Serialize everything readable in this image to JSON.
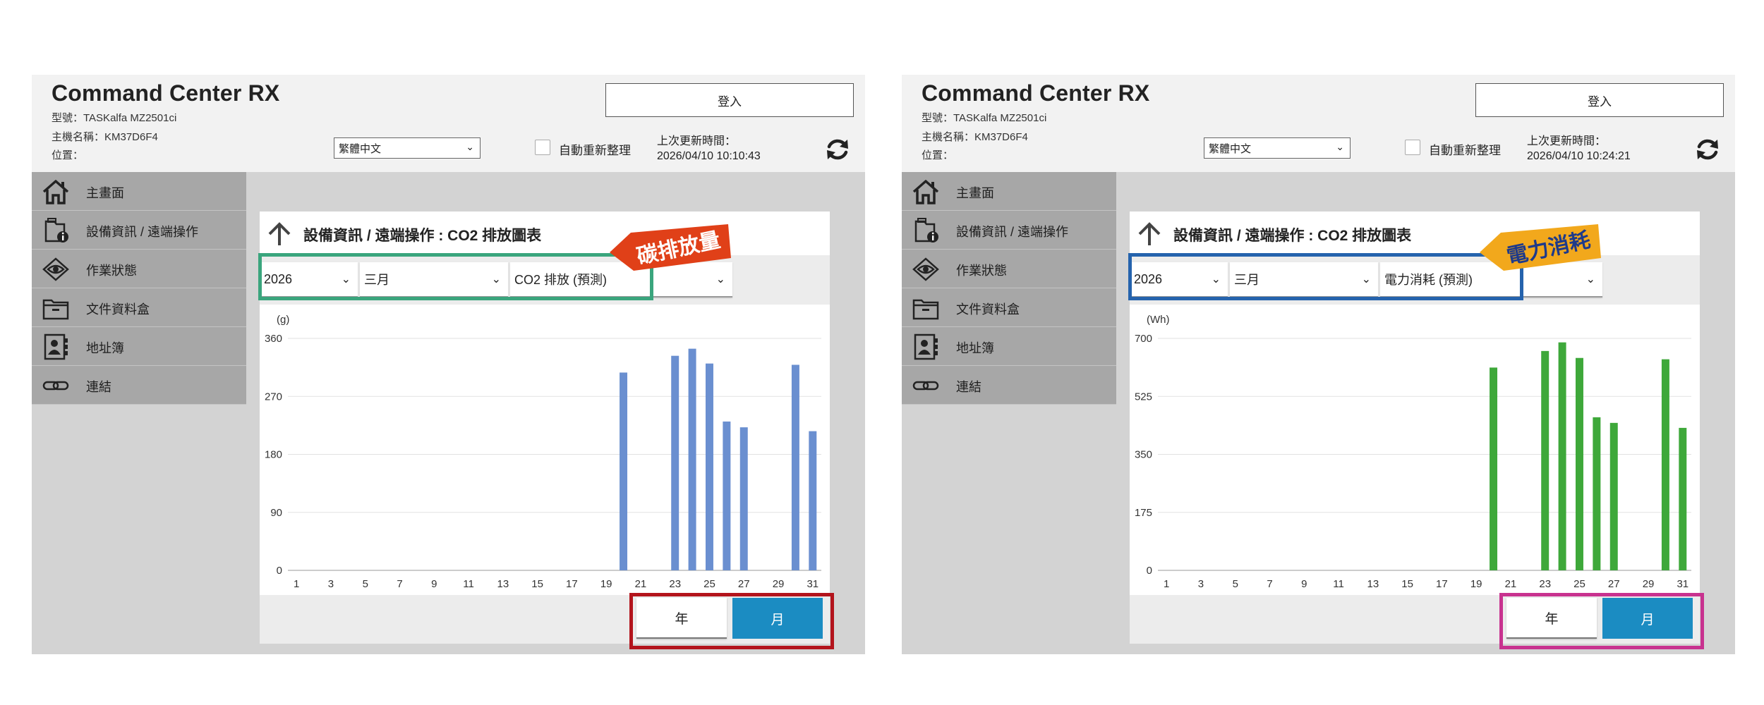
{
  "panels": [
    {
      "app_title": "Command Center RX",
      "model_line": "型號：TASKalfa MZ2501ci",
      "host_line": "主機名稱：KM37D6F4",
      "location_line": "位置：",
      "login_label": "登入",
      "language": "繁體中文",
      "auto_refresh_label": "自動重新整理",
      "last_update_label": "上次更新時間：",
      "last_update_value": "2026/04/10 10:10:43",
      "sidebar": [
        "主畫面",
        "設備資訊 / 遠端操作",
        "作業狀態",
        "文件資料盒",
        "地址簿",
        "連結"
      ],
      "breadcrumb": "設備資訊 / 遠端操作 : CO2 排放圖表",
      "year": "2026",
      "month": "三月",
      "metric": "CO2 排放 (預測)",
      "year_button": "年",
      "month_button": "月",
      "callout": "碳排放量",
      "highlight_color": "#3aa57d",
      "callout_color": "#e04018",
      "bottom_highlight_color": "#b3141c",
      "bar_color": "#6a8fd0"
    },
    {
      "app_title": "Command Center RX",
      "model_line": "型號：TASKalfa MZ2501ci",
      "host_line": "主機名稱：KM37D6F4",
      "location_line": "位置：",
      "login_label": "登入",
      "language": "繁體中文",
      "auto_refresh_label": "自動重新整理",
      "last_update_label": "上次更新時間：",
      "last_update_value": "2026/04/10 10:24:21",
      "sidebar": [
        "主畫面",
        "設備資訊 / 遠端操作",
        "作業狀態",
        "文件資料盒",
        "地址簿",
        "連結"
      ],
      "breadcrumb": "設備資訊 / 遠端操作 : CO2 排放圖表",
      "year": "2026",
      "month": "三月",
      "metric": "電力消耗 (預測)",
      "year_button": "年",
      "month_button": "月",
      "callout": "電力消耗",
      "highlight_color": "#2563ad",
      "callout_color": "#f2a81c",
      "bottom_highlight_color": "#c8328f",
      "bar_color": "#3ea83a"
    }
  ],
  "chart_data": [
    {
      "type": "bar",
      "ylabel": "(g)",
      "ylim": [
        0,
        360
      ],
      "yticks": [
        0,
        90,
        180,
        270,
        360
      ],
      "x": [
        1,
        2,
        3,
        4,
        5,
        6,
        7,
        8,
        9,
        10,
        11,
        12,
        13,
        14,
        15,
        16,
        17,
        18,
        19,
        20,
        21,
        22,
        23,
        24,
        25,
        26,
        27,
        28,
        29,
        30,
        31
      ],
      "xtick_labels": [
        "1",
        "3",
        "5",
        "7",
        "9",
        "11",
        "13",
        "15",
        "17",
        "19",
        "21",
        "23",
        "25",
        "27",
        "29",
        "31"
      ],
      "values": [
        0,
        0,
        0,
        0,
        0,
        0,
        0,
        0,
        0,
        0,
        0,
        0,
        0,
        0,
        0,
        0,
        0,
        0,
        0,
        307,
        0,
        0,
        333,
        344,
        321,
        231,
        222,
        0,
        0,
        319,
        216
      ],
      "grid": true
    },
    {
      "type": "bar",
      "ylabel": "(Wh)",
      "ylim": [
        0,
        700
      ],
      "yticks": [
        0,
        175,
        350,
        525,
        700
      ],
      "x": [
        1,
        2,
        3,
        4,
        5,
        6,
        7,
        8,
        9,
        10,
        11,
        12,
        13,
        14,
        15,
        16,
        17,
        18,
        19,
        20,
        21,
        22,
        23,
        24,
        25,
        26,
        27,
        28,
        29,
        30,
        31
      ],
      "xtick_labels": [
        "1",
        "3",
        "5",
        "7",
        "9",
        "11",
        "13",
        "15",
        "17",
        "19",
        "21",
        "23",
        "25",
        "27",
        "29",
        "31"
      ],
      "values": [
        0,
        0,
        0,
        0,
        0,
        0,
        0,
        0,
        0,
        0,
        0,
        0,
        0,
        0,
        0,
        0,
        0,
        0,
        0,
        612,
        0,
        0,
        662,
        688,
        641,
        462,
        445,
        0,
        0,
        637,
        430
      ],
      "grid": true
    }
  ]
}
